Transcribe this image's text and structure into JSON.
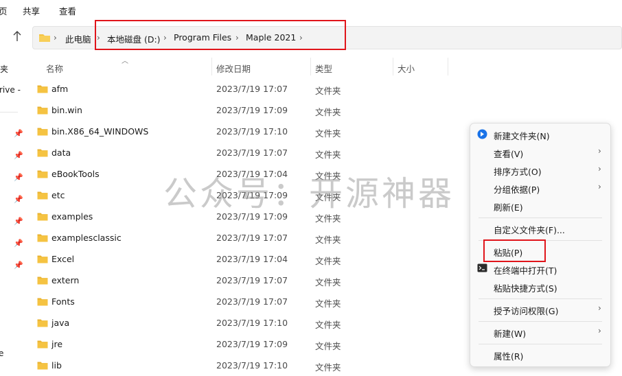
{
  "ribbon": {
    "partial_tab": "页",
    "share": "共享",
    "view": "查看"
  },
  "address": {
    "crumbs": [
      "此电脑",
      "本地磁盘 (D:)",
      "Program Files",
      "Maple 2021"
    ]
  },
  "sidebar": {
    "item_a": "夹",
    "item_b": "rive -",
    "item_c": "e"
  },
  "columns": {
    "name": "名称",
    "date": "修改日期",
    "type": "类型",
    "size": "大小"
  },
  "files": [
    {
      "name": "afm",
      "date": "2023/7/19 17:07",
      "type": "文件夹"
    },
    {
      "name": "bin.win",
      "date": "2023/7/19 17:09",
      "type": "文件夹"
    },
    {
      "name": "bin.X86_64_WINDOWS",
      "date": "2023/7/19 17:10",
      "type": "文件夹"
    },
    {
      "name": "data",
      "date": "2023/7/19 17:07",
      "type": "文件夹"
    },
    {
      "name": "eBookTools",
      "date": "2023/7/19 17:04",
      "type": "文件夹"
    },
    {
      "name": "etc",
      "date": "2023/7/19 17:09",
      "type": "文件夹"
    },
    {
      "name": "examples",
      "date": "2023/7/19 17:09",
      "type": "文件夹"
    },
    {
      "name": "examplesclassic",
      "date": "2023/7/19 17:07",
      "type": "文件夹"
    },
    {
      "name": "Excel",
      "date": "2023/7/19 17:04",
      "type": "文件夹"
    },
    {
      "name": "extern",
      "date": "2023/7/19 17:07",
      "type": "文件夹"
    },
    {
      "name": "Fonts",
      "date": "2023/7/19 17:07",
      "type": "文件夹"
    },
    {
      "name": "java",
      "date": "2023/7/19 17:10",
      "type": "文件夹"
    },
    {
      "name": "jre",
      "date": "2023/7/19 17:09",
      "type": "文件夹"
    },
    {
      "name": "lib",
      "date": "2023/7/19 17:10",
      "type": "文件夹"
    }
  ],
  "watermark": "公众号：开源神器",
  "context_menu": {
    "new_folder": "新建文件夹(N)",
    "view": "查看(V)",
    "sort_by": "排序方式(O)",
    "group_by": "分组依据(P)",
    "refresh": "刷新(E)",
    "customize": "自定义文件夹(F)...",
    "paste": "粘贴(P)",
    "open_terminal": "在终端中打开(T)",
    "paste_shortcut": "粘贴快捷方式(S)",
    "grant_access": "授予访问权限(G)",
    "new": "新建(W)",
    "properties": "属性(R)"
  },
  "colors": {
    "folder": "#f5c342",
    "folder_dark": "#e8b230",
    "highlight": "#e0141a",
    "new_folder_icon": "#1a73e8"
  }
}
